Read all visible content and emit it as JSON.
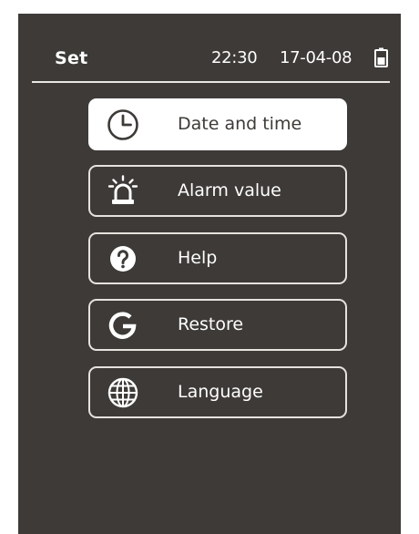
{
  "header": {
    "title": "Set",
    "time": "22:30",
    "date": "17-04-08"
  },
  "menu": {
    "items": [
      {
        "label": "Date and time",
        "icon": "clock-icon",
        "selected": true
      },
      {
        "label": "Alarm value",
        "icon": "alarm-icon",
        "selected": false
      },
      {
        "label": "Help",
        "icon": "help-icon",
        "selected": false
      },
      {
        "label": "Restore",
        "icon": "restore-icon",
        "selected": false
      },
      {
        "label": "Language",
        "icon": "globe-icon",
        "selected": false
      }
    ]
  },
  "colors": {
    "screen_bg": "#3d3a37",
    "text": "#ffffff",
    "selected_bg": "#ffffff",
    "selected_text": "#3d3a37"
  }
}
